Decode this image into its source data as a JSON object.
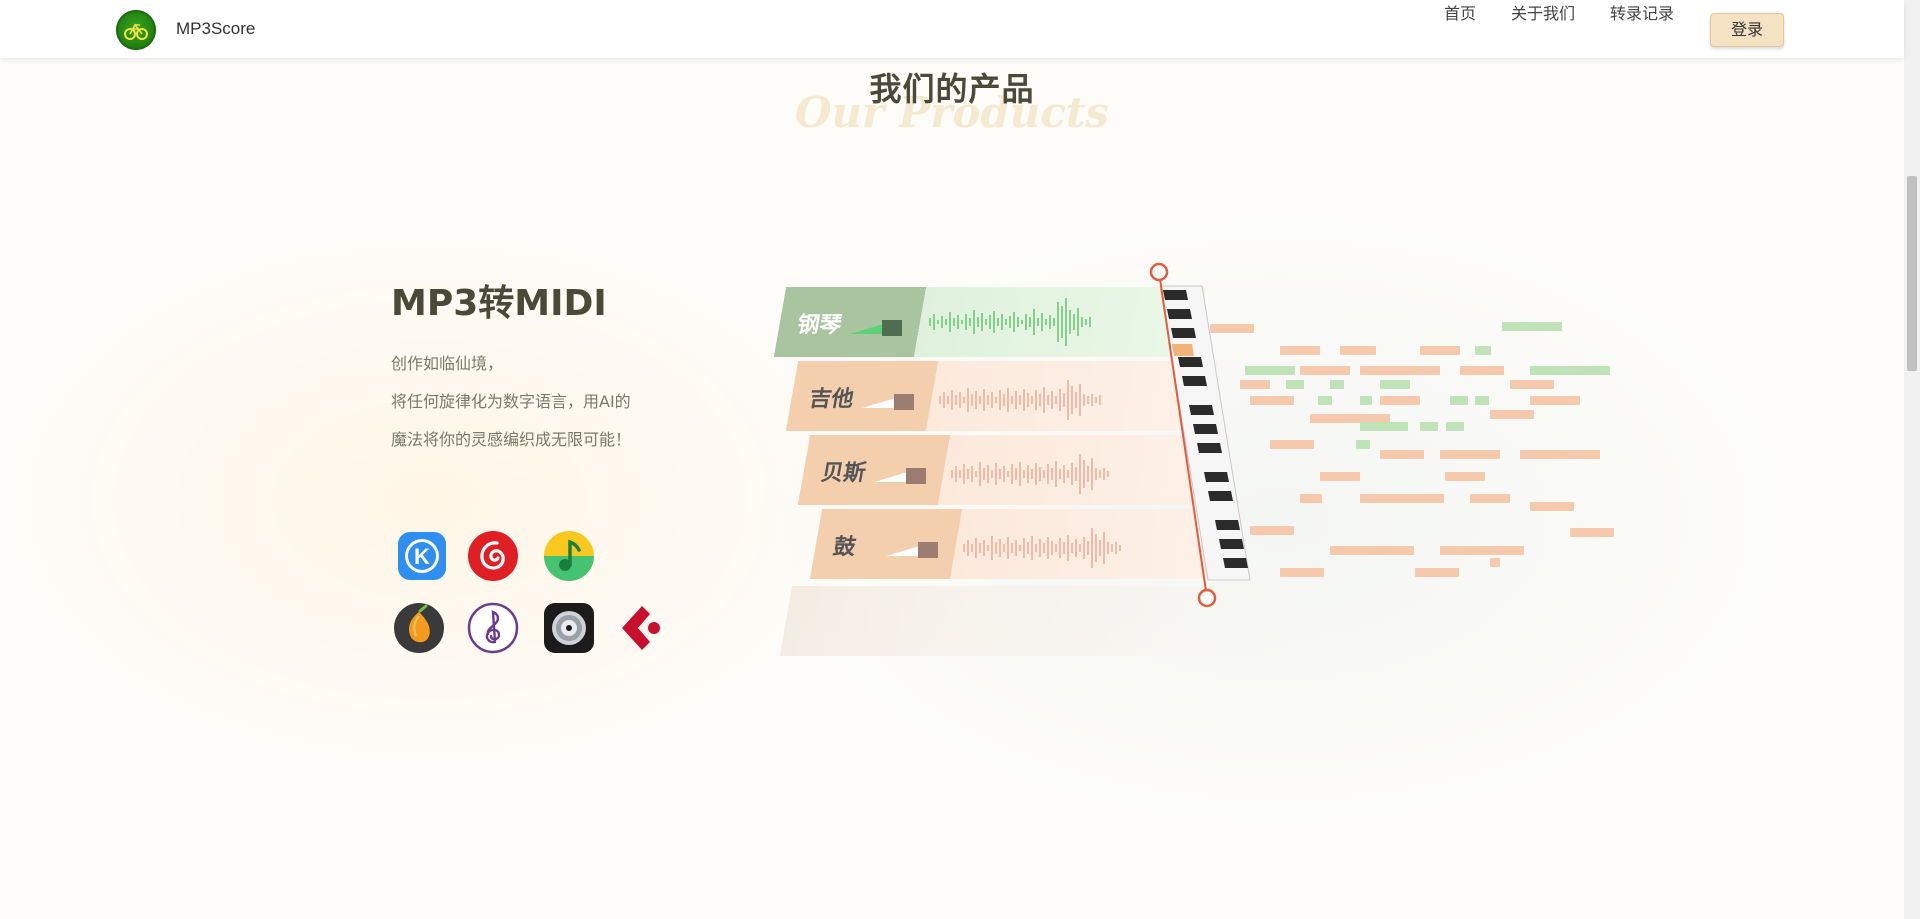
{
  "navbar": {
    "brand": "MP3Score",
    "links": [
      "首页",
      "关于我们",
      "转录记录"
    ],
    "login_label": "登录"
  },
  "section": {
    "title": "我们的产品",
    "subtitle": "Our Products"
  },
  "product": {
    "title": "MP3转MIDI",
    "description": [
      "创作如临仙境，",
      "将任何旋律化为数字语言，用AI的",
      "魔法将你的灵感编织成无限可能！"
    ]
  },
  "platforms": [
    {
      "icon": "kugou-icon"
    },
    {
      "icon": "netease-music-icon"
    },
    {
      "icon": "qq-music-icon"
    },
    {
      "icon": "fl-studio-icon"
    },
    {
      "icon": "musescore-icon"
    },
    {
      "icon": "logic-pro-icon"
    },
    {
      "icon": "cubase-icon"
    }
  ],
  "tracks": [
    "钢琴",
    "吉他",
    "贝斯",
    "鼓"
  ],
  "colors": {
    "accent": "#f5e2c2",
    "piano_track": "#a8c5a0",
    "other_track": "#f4cfae",
    "playhead": "#e65b3c"
  }
}
